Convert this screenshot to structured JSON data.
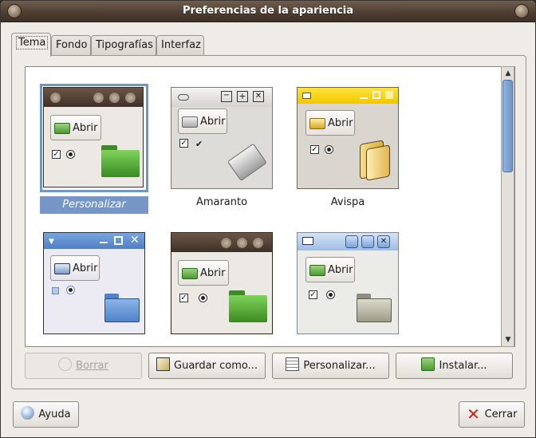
{
  "window": {
    "title": "Preferencias de la apariencia"
  },
  "tabs": [
    {
      "label": "Tema",
      "active": true
    },
    {
      "label": "Fondo",
      "active": false
    },
    {
      "label": "Tipografías",
      "active": false
    },
    {
      "label": "Interfaz",
      "active": false
    }
  ],
  "themes": [
    {
      "name": "Personalizar",
      "selected": true,
      "button_label": "Abrir"
    },
    {
      "name": "Amaranto",
      "selected": false,
      "button_label": "Abrir"
    },
    {
      "name": "Avispa",
      "selected": false,
      "button_label": "Abrir"
    },
    {
      "name": "",
      "selected": false,
      "button_label": "Abrir"
    },
    {
      "name": "",
      "selected": false,
      "button_label": "Abrir"
    },
    {
      "name": "",
      "selected": false,
      "button_label": "Abrir"
    }
  ],
  "actions": {
    "delete_label": "Borrar",
    "save_as_label": "Guardar como...",
    "customize_label": "Personalizar...",
    "install_label": "Instalar..."
  },
  "footer": {
    "help_label": "Ayuda",
    "close_label": "Cerrar"
  },
  "colors": {
    "accent": "#7596c6",
    "titlebar": "#4c3d31",
    "avispa_title": "#f6d200",
    "blue_title": "#5d8ed0"
  }
}
